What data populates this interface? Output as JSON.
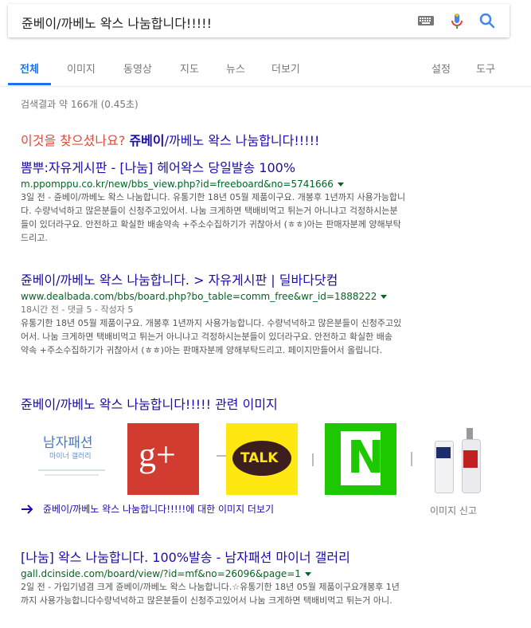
{
  "search": {
    "query": "쥰베이/까베노 왁스 나눔합니다!!!!!"
  },
  "tabs": [
    {
      "label": "전체"
    },
    {
      "label": "이미지"
    },
    {
      "label": "동영상"
    },
    {
      "label": "지도"
    },
    {
      "label": "뉴스"
    },
    {
      "label": "더보기"
    },
    {
      "label": "설정"
    },
    {
      "label": "도구"
    }
  ],
  "stats": "검색결과 약 166개 (0.45초)",
  "did_you_mean": {
    "label": "이것을 찾으셨나요?",
    "bold": "쥬베이",
    "rest": "/까베노 왁스 나눔합니다!!!!!"
  },
  "results": [
    {
      "title_pre": "뽐뿌:자유게시판 - [나눔] 헤어왁스 당일발송 100%",
      "url": "m.ppomppu.co.kr/new/bbs_view.php?id=freeboard&no=5741666",
      "meta": "",
      "snippet": [
        "3일 전 - 쥰베이/까베노 왁스 나눔합니다. 유통기한 18년 05월 제품이구요. 개봉후 1년까지 사용가능합니",
        "다. 수량넉넉하고 많은분들이 신청주고있어서. 나눔 크게하면 택배비먹고 튀는거 아니냐고 걱정하시는분",
        "들이 있더라구요. 안전하고 확실한 배송약속 +주소수집하기가 귀찮아서 (ㅎㅎ)아는 판매자분께 양해부탁",
        "드리고."
      ]
    },
    {
      "title_pre": "쥰베이/까베노 왁스 나눔합니다. > 자유게시판 | 딜바다닷컴",
      "url": "www.dealbada.com/bbs/board.php?bo_table=comm_free&wr_id=1888222",
      "meta": "18시간 전 - 댓글 5 - 작성자 5",
      "snippet": [
        "유통기한 18년 05월 제품이구요. 개봉후 1년까지 사용가능합니다. 수량넉넉하고 많은분들이 신청주고있",
        "어서. 나눔 크게하면 택배비먹고 튀는거 아니냐고 걱정하시는분들이 있더라구요. 안전하고 확실한 배송",
        "약속 +주소수집하기가 귀찮아서 (ㅎㅎ)아는 판매자분께 양해부탁드리고. 페이지만들어서 올립니다."
      ]
    },
    {
      "title_pre": "[나눔] 왁스 나눔합니다. 100%발송 - 남자패션 마이너 갤러리",
      "url": "gall.dcinside.com/board/view/?id=mf&no=26096&page=1",
      "meta": "",
      "snippet": [
        "2일 전 - 가입기념겸 크게 쥰베이/까베노 왁스 나눔합니다.☆유통기한 18년 05월 제품이구요개봉후 1년",
        "까지 사용가능합니다수량넉넉하고 많은분들이 신청주고있어서 나눔 크게하면 택배비먹고 튀는거 아니."
      ]
    }
  ],
  "images_section": {
    "title": "쥰베이/까베노 왁스 나눔합니다!!!!! 관련 이미지",
    "thumb1_line1": "남자패션",
    "thumb1_line2": "마이너 갤러리",
    "thumb2_text": "g+",
    "thumb3_text": "TALK",
    "thumb4_text": "N",
    "more_link": "쥰베이/까베노 왁스 나눔합니다!!!!!에 대한 이미지 더보기",
    "report": "이미지 신고"
  }
}
